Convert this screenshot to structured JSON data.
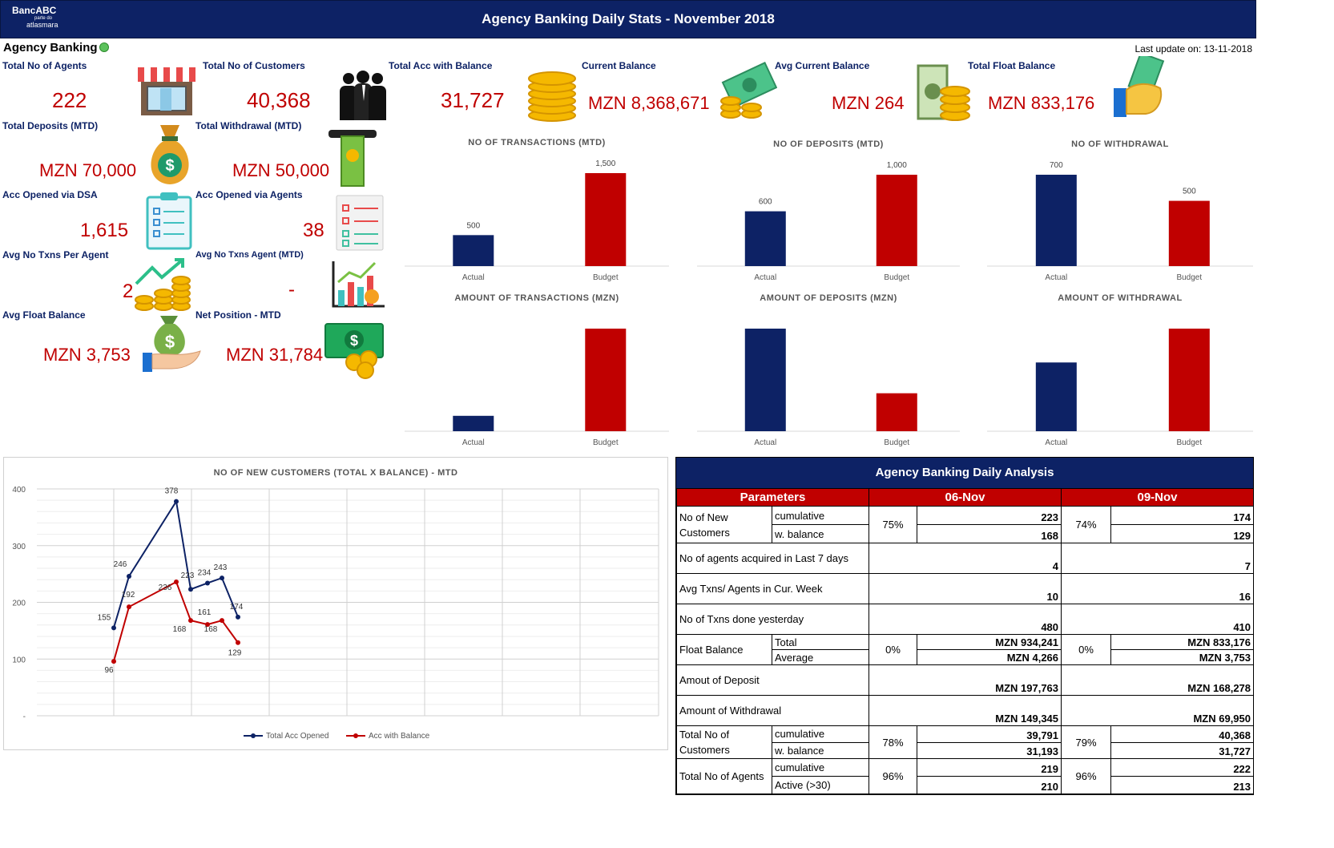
{
  "header": {
    "title": "Agency Banking Daily Stats - November 2018",
    "logo_line1": "BancABC",
    "logo_line2": "parte do",
    "logo_line3": "atlasmara"
  },
  "subtitle": "Agency Banking",
  "last_update": "Last update on: 13-11-2018",
  "kpis": [
    {
      "label": "Total No of Agents",
      "value": "222",
      "icon": "storefront-icon"
    },
    {
      "label": "Total No of Customers",
      "value": "40,368",
      "icon": "people-icon"
    },
    {
      "label": "Total Acc with Balance",
      "value": "31,727",
      "icon": "coin-stack-icon"
    },
    {
      "label": "Current Balance",
      "value": "MZN 8,368,671",
      "icon": "cash-coins-icon"
    },
    {
      "label": "Avg Current Balance",
      "value": "MZN 264",
      "icon": "money-coins-icon"
    },
    {
      "label": "Total Float Balance",
      "value": "MZN 833,176",
      "icon": "hand-cash-icon"
    },
    {
      "label": "Total Deposits (MTD)",
      "value": "MZN 70,000",
      "icon": "money-bag-icon"
    },
    {
      "label": "Total Withdrawal (MTD)",
      "value": "MZN 50,000",
      "icon": "atm-cash-icon"
    },
    {
      "label": "Acc Opened via DSA",
      "value": "1,615",
      "icon": "clipboard-checklist-icon"
    },
    {
      "label": "Acc Opened via Agents",
      "value": "38",
      "icon": "checklist-icon"
    },
    {
      "label": "Avg No Txns Per Agent",
      "value": "2",
      "icon": "growth-coins-icon"
    },
    {
      "label": "Avg No Txns Agent (MTD)",
      "value": "-",
      "icon": "bar-chart-icon"
    },
    {
      "label": "Avg Float Balance",
      "value": "MZN 3,753",
      "icon": "hand-money-bag-icon"
    },
    {
      "label": "Net Position - MTD",
      "value": "MZN 31,784",
      "icon": "banknote-coins-icon"
    }
  ],
  "colors": {
    "navy": "#0d2265",
    "red": "#c00000",
    "green_dot": "#5cc25c"
  },
  "chart_data": [
    {
      "type": "bar",
      "title": "NO OF TRANSACTIONS (MTD)",
      "categories": [
        "Actual",
        "Budget"
      ],
      "values": [
        500,
        1500
      ],
      "data_labels": [
        "500",
        "1,500"
      ],
      "colors": [
        "#0d2265",
        "#c00000"
      ]
    },
    {
      "type": "bar",
      "title": "NO OF DEPOSITS (MTD)",
      "categories": [
        "Actual",
        "Budget"
      ],
      "values": [
        600,
        1000
      ],
      "data_labels": [
        "600",
        "1,000"
      ],
      "colors": [
        "#0d2265",
        "#c00000"
      ]
    },
    {
      "type": "bar",
      "title": "NO OF WITHDRAWAL",
      "categories": [
        "Actual",
        "Budget"
      ],
      "values": [
        700,
        500
      ],
      "data_labels": [
        "700",
        "500"
      ],
      "colors": [
        "#0d2265",
        "#c00000"
      ]
    },
    {
      "type": "bar",
      "title": "AMOUNT OF TRANSACTIONS (MZN)",
      "categories": [
        "Actual",
        "Budget"
      ],
      "values": [
        15,
        100
      ],
      "colors": [
        "#0d2265",
        "#c00000"
      ]
    },
    {
      "type": "bar",
      "title": "AMOUNT OF DEPOSITS (MZN)",
      "categories": [
        "Actual",
        "Budget"
      ],
      "values": [
        100,
        37
      ],
      "colors": [
        "#0d2265",
        "#c00000"
      ]
    },
    {
      "type": "bar",
      "title": "AMOUNT OF WITHDRAWAL",
      "categories": [
        "Actual",
        "Budget"
      ],
      "values": [
        67,
        100
      ],
      "colors": [
        "#0d2265",
        "#c00000"
      ]
    },
    {
      "type": "line",
      "title": "NO OF NEW CUSTOMERS (TOTAL X BALANCE) - MTD",
      "x": [
        1,
        2,
        3,
        4,
        5,
        6,
        7,
        8
      ],
      "ylim": [
        0,
        400
      ],
      "yticks": [
        "-",
        "100",
        "200",
        "300",
        "400"
      ],
      "grid": true,
      "legend": "bottom",
      "series": [
        {
          "name": "Total Acc Opened",
          "color": "#0d2265",
          "points": [
            [
              1,
              155
            ],
            [
              2,
              246
            ],
            [
              3,
              378
            ],
            [
              4,
              223
            ],
            [
              5,
              234
            ],
            [
              6,
              243
            ],
            [
              7,
              174
            ]
          ]
        },
        {
          "name": "Acc with Balance",
          "color": "#c00000",
          "points": [
            [
              1,
              96
            ],
            [
              2,
              192
            ],
            [
              3,
              236
            ],
            [
              4,
              168
            ],
            [
              5,
              161
            ],
            [
              6,
              168
            ],
            [
              7,
              129
            ]
          ]
        }
      ]
    }
  ],
  "analysis": {
    "title": "Agency Banking Daily Analysis",
    "headers": [
      "Parameters",
      "06-Nov",
      "09-Nov"
    ],
    "rows": {
      "new_customers": {
        "label": "No of New Customers",
        "sub1": "cumulative",
        "sub2": "w. balance",
        "d1_pct": "75%",
        "d1_v1": "223",
        "d1_v2": "168",
        "d2_pct": "74%",
        "d2_v1": "174",
        "d2_v2": "129"
      },
      "agents_acquired": {
        "label": "No of agents acquired in Last 7 days",
        "d1": "4",
        "d2": "7"
      },
      "avg_txns": {
        "label": "Avg Txns/ Agents in Cur. Week",
        "d1": "10",
        "d2": "16"
      },
      "txns_yesterday": {
        "label": "No of Txns done yesterday",
        "d1": "480",
        "d2": "410"
      },
      "float_balance": {
        "label": "Float Balance",
        "sub1": "Total",
        "sub2": "Average",
        "d1_pct": "0%",
        "d1_v1": "MZN 934,241",
        "d1_v2": "MZN 4,266",
        "d2_pct": "0%",
        "d2_v1": "MZN 833,176",
        "d2_v2": "MZN 3,753"
      },
      "deposit": {
        "label": "Amout of Deposit",
        "d1": "MZN 197,763",
        "d2": "MZN 168,278"
      },
      "withdrawal": {
        "label": "Amount of Withdrawal",
        "d1": "MZN 149,345",
        "d2": "MZN 69,950"
      },
      "total_customers": {
        "label": "Total No of Customers",
        "sub1": "cumulative",
        "sub2": "w. balance",
        "d1_pct": "78%",
        "d1_v1": "39,791",
        "d1_v2": "31,193",
        "d2_pct": "79%",
        "d2_v1": "40,368",
        "d2_v2": "31,727"
      },
      "total_agents": {
        "label": "Total No of Agents",
        "sub1": "cumulative",
        "sub2": "Active (>30)",
        "d1_pct": "96%",
        "d1_v1": "219",
        "d1_v2": "210",
        "d2_pct": "96%",
        "d2_v1": "222",
        "d2_v2": "213"
      }
    }
  }
}
